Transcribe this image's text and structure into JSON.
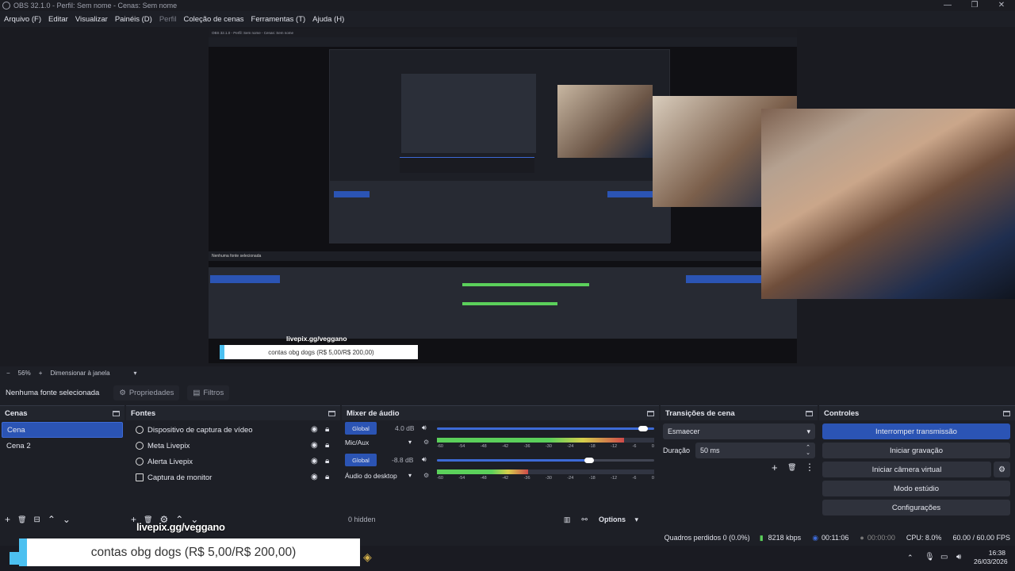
{
  "window": {
    "title": "OBS 32.1.0 - Perfil: Sem nome - Cenas: Sem nome",
    "controls": [
      "—",
      "❐",
      "✕"
    ]
  },
  "menu": [
    {
      "label": "Arquivo (F)",
      "dim": false
    },
    {
      "label": "Editar",
      "dim": false
    },
    {
      "label": "Visualizar",
      "dim": false
    },
    {
      "label": "Painéis (D)",
      "dim": false
    },
    {
      "label": "Perfil",
      "dim": true
    },
    {
      "label": "Coleção de cenas",
      "dim": false
    },
    {
      "label": "Ferramentas (T)",
      "dim": false
    },
    {
      "label": "Ajuda (H)",
      "dim": false
    }
  ],
  "preview_bar": {
    "minus": "−",
    "zoom": "56%",
    "plus": "+",
    "fit": "Dimensionar à janela",
    "dropdown": "▾"
  },
  "context": {
    "no_source": "Nenhuma fonte selecionada",
    "properties": "Propriedades",
    "filters": "Filtros"
  },
  "scenes": {
    "title": "Cenas",
    "items": [
      {
        "label": "Cena",
        "selected": true
      },
      {
        "label": "Cena 2",
        "selected": false
      }
    ],
    "toolbar": [
      "+",
      "🗑",
      "⊟",
      "⌃",
      "⌄"
    ]
  },
  "sources": {
    "title": "Fontes",
    "items": [
      {
        "label": "Dispositivo de captura de vídeo",
        "icon": "camera-icon"
      },
      {
        "label": "Meta Livepix",
        "icon": "globe-icon"
      },
      {
        "label": "Alerta Livepix",
        "icon": "globe-icon"
      },
      {
        "label": "Captura de monitor",
        "icon": "monitor-icon"
      }
    ],
    "toolbar": [
      "+",
      "🗑",
      "⚙",
      "⌃",
      "⌄"
    ]
  },
  "mixer": {
    "title": "Mixer de áudio",
    "channels": [
      {
        "name": "Mic/Aux",
        "global": "Global",
        "db": "4.0 dB",
        "level": 0.95,
        "meter": 0.86
      },
      {
        "name": "Áudio do desktop",
        "global": "Global",
        "db": "-8.8 dB",
        "level": 0.7,
        "meter": 0.42
      }
    ],
    "ticks": [
      "-60",
      "-54",
      "-48",
      "-42",
      "-36",
      "-30",
      "-24",
      "-18",
      "-12",
      "-6",
      "0"
    ],
    "hidden": "0 hidden",
    "options": "Options"
  },
  "transitions": {
    "title": "Transições de cena",
    "type": "Esmaecer",
    "duration_label": "Duração",
    "duration_value": "50 ms"
  },
  "controls": {
    "title": "Controles",
    "buttons": [
      {
        "label": "Interromper transmissão",
        "primary": true
      },
      {
        "label": "Iniciar gravação",
        "primary": false
      },
      {
        "label": "Iniciar câmera virtual",
        "primary": false
      },
      {
        "label": "Modo estúdio",
        "primary": false
      },
      {
        "label": "Configurações",
        "primary": false
      }
    ]
  },
  "status": {
    "dropped": "Quadros perdidos 0 (0.0%)",
    "bitrate": "8218 kbps",
    "stream_time": "00:11:06",
    "rec_time": "00:00:00",
    "cpu": "CPU: 8.0%",
    "fps": "60.00 / 60.00 FPS"
  },
  "overlay": {
    "url": "livepix.gg/veggano",
    "donation": "contas obg dogs (R$ 5,00/R$ 200,00)"
  },
  "taskbar": {
    "time": "16:38",
    "date": "26/03/2026"
  },
  "nested_preview": {
    "title": "OBS 32.1.0 - Perfil: Sem nome - Cenas: Sem nome",
    "no_source": "Nenhuma fonte selecionada",
    "url": "livepix.gg/veggano",
    "donation": "contas obg dogs (R$ 5,00/R$ 200,00)"
  },
  "colors": {
    "accent": "#2b54b4",
    "bg": "#1d1f26",
    "dock": "#272a33"
  }
}
